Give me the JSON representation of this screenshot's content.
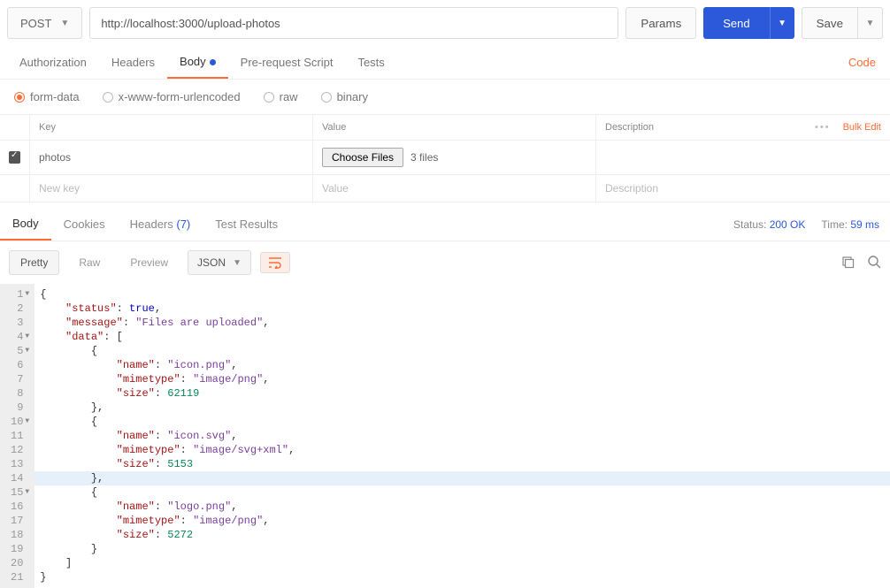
{
  "top": {
    "method": "POST",
    "url": "http://localhost:3000/upload-photos",
    "params": "Params",
    "send": "Send",
    "save": "Save"
  },
  "req_tabs": {
    "auth": "Authorization",
    "headers": "Headers",
    "body": "Body",
    "prereq": "Pre-request Script",
    "tests": "Tests",
    "code": "Code"
  },
  "body_types": {
    "formdata": "form-data",
    "urlenc": "x-www-form-urlencoded",
    "raw": "raw",
    "binary": "binary"
  },
  "grid": {
    "h_key": "Key",
    "h_value": "Value",
    "h_desc": "Description",
    "bulk": "Bulk Edit",
    "row_key": "photos",
    "choose": "Choose Files",
    "files_count": "3 files",
    "ph_key": "New key",
    "ph_value": "Value",
    "ph_desc": "Description"
  },
  "resp_tabs": {
    "body": "Body",
    "cookies": "Cookies",
    "headers": "Headers",
    "headers_count": "(7)",
    "tests": "Test Results"
  },
  "status": {
    "status_l": "Status:",
    "status_v": "200 OK",
    "time_l": "Time:",
    "time_v": "59 ms"
  },
  "view": {
    "pretty": "Pretty",
    "raw": "Raw",
    "preview": "Preview",
    "fmt": "JSON"
  },
  "json_body": {
    "status": true,
    "message": "Files are uploaded",
    "data": [
      {
        "name": "icon.png",
        "mimetype": "image/png",
        "size": 62119
      },
      {
        "name": "icon.svg",
        "mimetype": "image/svg+xml",
        "size": 5153
      },
      {
        "name": "logo.png",
        "mimetype": "image/png",
        "size": 5272
      }
    ]
  },
  "code_lines": [
    {
      "n": 1,
      "arrow": true,
      "raw": "{"
    },
    {
      "n": 2,
      "arrow": false,
      "indent": 4,
      "key": "status",
      "bool": "true",
      "comma": true
    },
    {
      "n": 3,
      "arrow": false,
      "indent": 4,
      "key": "message",
      "str": "Files are uploaded",
      "comma": true
    },
    {
      "n": 4,
      "arrow": true,
      "indent": 4,
      "key": "data",
      "open": "["
    },
    {
      "n": 5,
      "arrow": true,
      "indent": 8,
      "raw": "{"
    },
    {
      "n": 6,
      "arrow": false,
      "indent": 12,
      "key": "name",
      "str": "icon.png",
      "comma": true
    },
    {
      "n": 7,
      "arrow": false,
      "indent": 12,
      "key": "mimetype",
      "str": "image/png",
      "comma": true
    },
    {
      "n": 8,
      "arrow": false,
      "indent": 12,
      "key": "size",
      "num": "62119"
    },
    {
      "n": 9,
      "arrow": false,
      "indent": 8,
      "raw": "},"
    },
    {
      "n": 10,
      "arrow": true,
      "indent": 8,
      "raw": "{"
    },
    {
      "n": 11,
      "arrow": false,
      "indent": 12,
      "key": "name",
      "str": "icon.svg",
      "comma": true
    },
    {
      "n": 12,
      "arrow": false,
      "indent": 12,
      "key": "mimetype",
      "str": "image/svg+xml",
      "comma": true
    },
    {
      "n": 13,
      "arrow": false,
      "indent": 12,
      "key": "size",
      "num": "5153"
    },
    {
      "n": 14,
      "arrow": false,
      "indent": 8,
      "raw": "},",
      "hl": true
    },
    {
      "n": 15,
      "arrow": true,
      "indent": 8,
      "raw": "{"
    },
    {
      "n": 16,
      "arrow": false,
      "indent": 12,
      "key": "name",
      "str": "logo.png",
      "comma": true
    },
    {
      "n": 17,
      "arrow": false,
      "indent": 12,
      "key": "mimetype",
      "str": "image/png",
      "comma": true
    },
    {
      "n": 18,
      "arrow": false,
      "indent": 12,
      "key": "size",
      "num": "5272"
    },
    {
      "n": 19,
      "arrow": false,
      "indent": 8,
      "raw": "}"
    },
    {
      "n": 20,
      "arrow": false,
      "indent": 4,
      "raw": "]"
    },
    {
      "n": 21,
      "arrow": false,
      "raw": "}"
    }
  ]
}
